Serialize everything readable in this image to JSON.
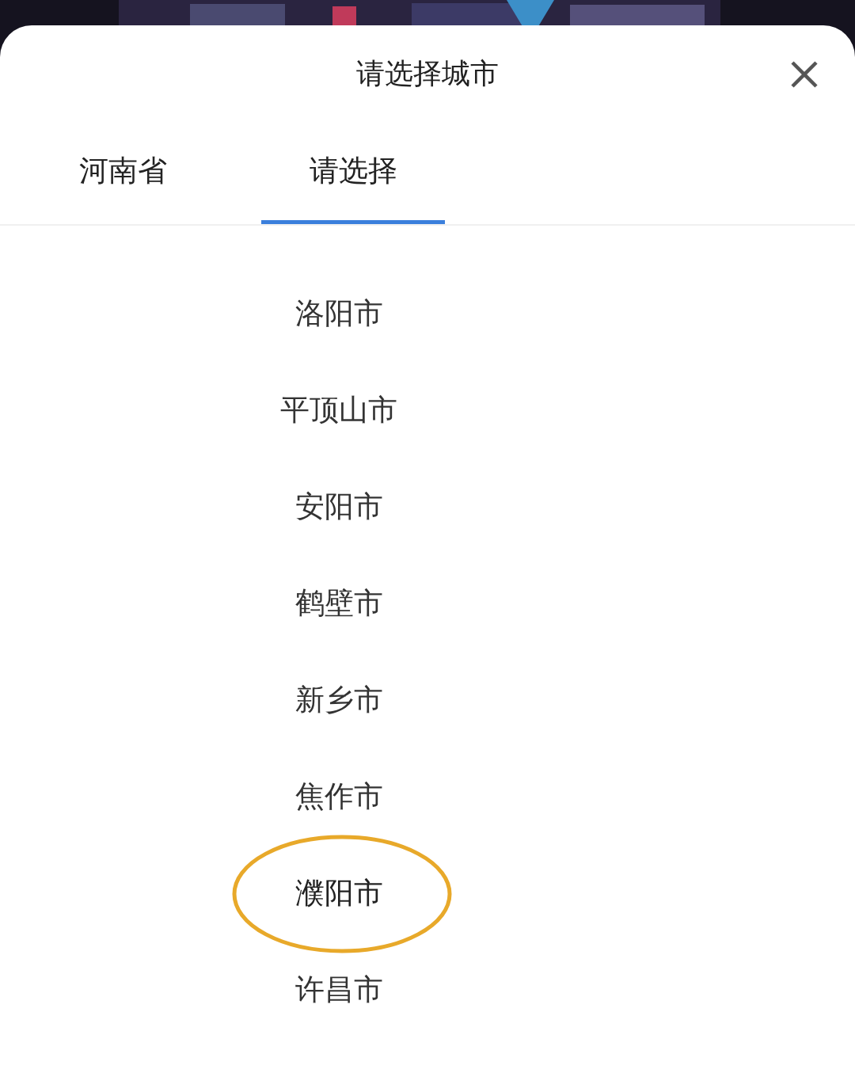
{
  "sheet": {
    "title": "请选择城市"
  },
  "tabs": [
    {
      "label": "河南省",
      "selected": false
    },
    {
      "label": "请选择",
      "selected": true
    }
  ],
  "cities": [
    {
      "name": "洛阳市",
      "highlighted": false
    },
    {
      "name": "平顶山市",
      "highlighted": false
    },
    {
      "name": "安阳市",
      "highlighted": false
    },
    {
      "name": "鹤壁市",
      "highlighted": false
    },
    {
      "name": "新乡市",
      "highlighted": false
    },
    {
      "name": "焦作市",
      "highlighted": false
    },
    {
      "name": "濮阳市",
      "highlighted": true
    },
    {
      "name": "许昌市",
      "highlighted": false
    }
  ]
}
